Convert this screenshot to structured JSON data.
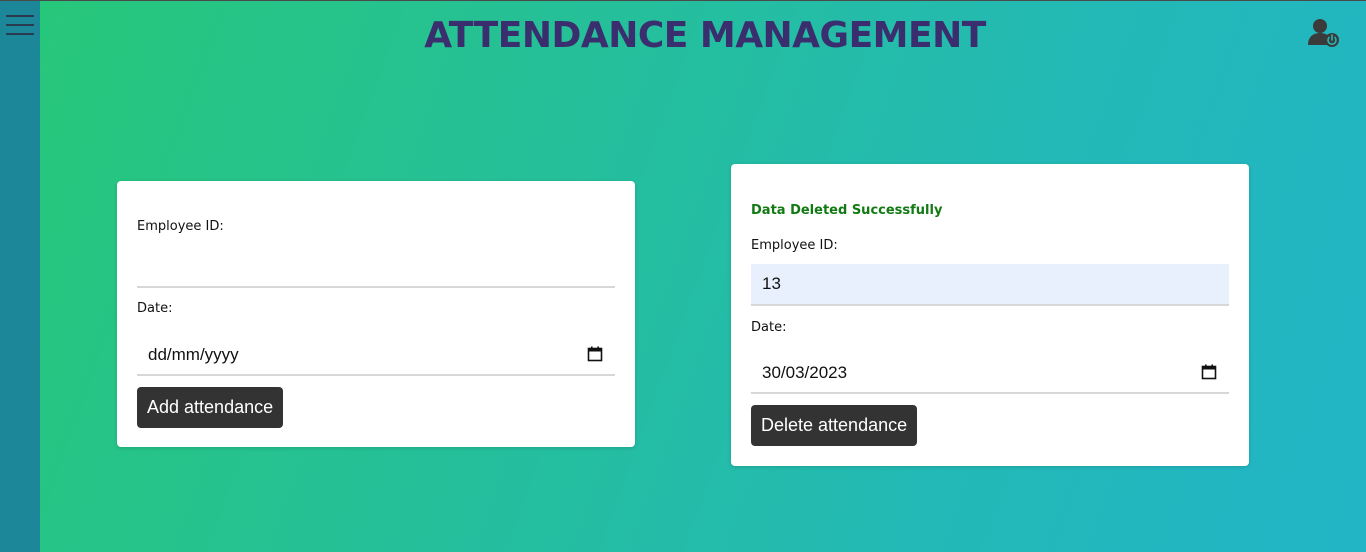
{
  "header": {
    "title": "ATTENDANCE MANAGEMENT",
    "menu_icon": "hamburger-menu-icon",
    "user_icon": "user-logout-icon"
  },
  "add_form": {
    "employee_id_label": "Employee ID:",
    "employee_id_value": "",
    "date_label": "Date:",
    "date_value": "dd/mm/yyyy",
    "button_label": "Add attendance"
  },
  "delete_form": {
    "message": "Data Deleted Successfully",
    "employee_id_label": "Employee ID:",
    "employee_id_value": "13",
    "date_label": "Date:",
    "date_value": "30/03/2023",
    "button_label": "Delete attendance"
  },
  "colors": {
    "sidebar": "#1b8798",
    "gradient_start": "#27c77a",
    "gradient_end": "#22b5c7",
    "title": "#3a2e6e",
    "success": "#127a12",
    "button": "#333333",
    "autofill": "#e8f0fe"
  }
}
